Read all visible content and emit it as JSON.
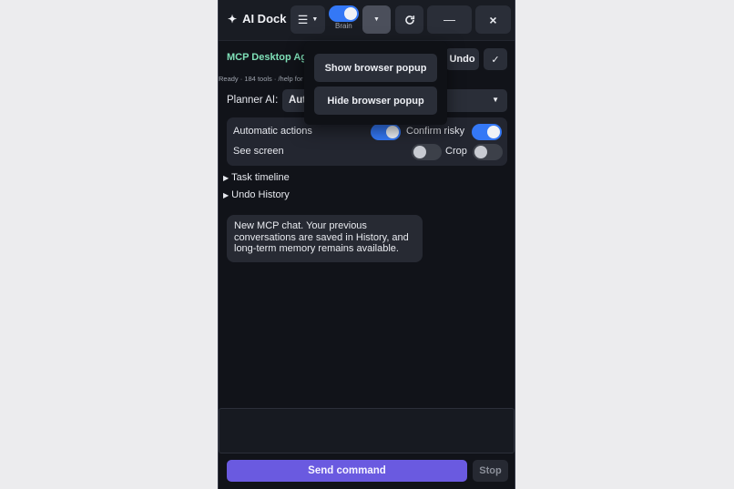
{
  "app": {
    "title": "AI Dock",
    "brand_icon": "sparkle-icon"
  },
  "header": {
    "menu_button_icon": "hamburger-menu-icon",
    "brain_toggle": {
      "label": "Brain",
      "on": true
    },
    "dropdown_button_icon": "chevron-down-icon",
    "refresh_icon": "refresh-icon",
    "minimize_label": "—",
    "close_label": "×"
  },
  "agent": {
    "title": "MCP Desktop Ag",
    "status": "Ready · 184 tools · /help for",
    "undo_label": "Undo",
    "check_label": "✓"
  },
  "planner": {
    "label": "Planner AI:",
    "value": "Aut"
  },
  "options": {
    "automatic_actions": {
      "label": "Automatic actions",
      "on": true
    },
    "confirm_risky": {
      "label": "Confirm risky",
      "on": true
    },
    "see_screen": {
      "label": "See screen",
      "on": false
    },
    "crop": {
      "label": "Crop",
      "on": false
    }
  },
  "sections": {
    "task_timeline": "Task timeline",
    "undo_history": "Undo History"
  },
  "chat": {
    "messages": [
      {
        "text": "New MCP chat. Your previous conversations are saved in History, and long-term memory remains available."
      }
    ]
  },
  "composer": {
    "value": ""
  },
  "actions": {
    "send_label": "Send command",
    "stop_label": "Stop"
  },
  "popup": {
    "show_label": "Show browser popup",
    "hide_label": "Hide browser popup"
  },
  "colors": {
    "accent": "#3478f6",
    "send": "#6a5ae0",
    "title_green": "#7fe0b8",
    "panel_bg": "#111319"
  }
}
